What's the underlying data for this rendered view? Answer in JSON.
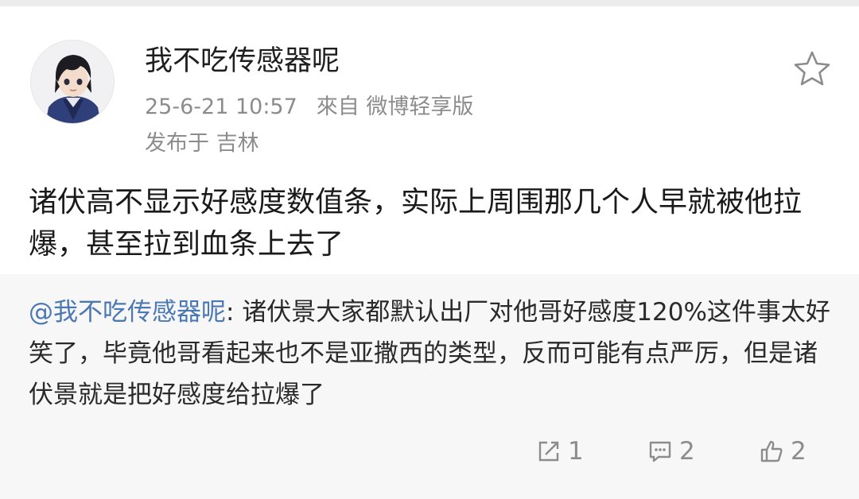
{
  "post": {
    "author": "我不吃传感器呢",
    "timestamp": "25-6-21 10:57",
    "source": "來自 微博轻享版",
    "location": "发布于 吉林",
    "text": "诸伏高不显示好感度数值条，实际上周围那几个人早就被他拉爆，甚至拉到血条上去了"
  },
  "repost": {
    "mention": "@我不吃传感器呢",
    "text": ": 诸伏景大家都默认出厂对他哥好感度120%这件事太好笑了，毕竟他哥看起来也不是亚撒西的类型，反而可能有点严厉，但是诸伏景就是把好感度给拉爆了"
  },
  "actions": {
    "repost_count": "1",
    "comment_count": "2",
    "like_count": "2"
  },
  "icons": {
    "favorite": "star-outline-icon",
    "repost": "share-box-icon",
    "comment": "comment-bubble-icon",
    "like": "thumbs-up-icon"
  },
  "colors": {
    "mention": "#4a78b5",
    "meta": "#8c8c8c",
    "repost_bg": "#f7f7f7"
  }
}
